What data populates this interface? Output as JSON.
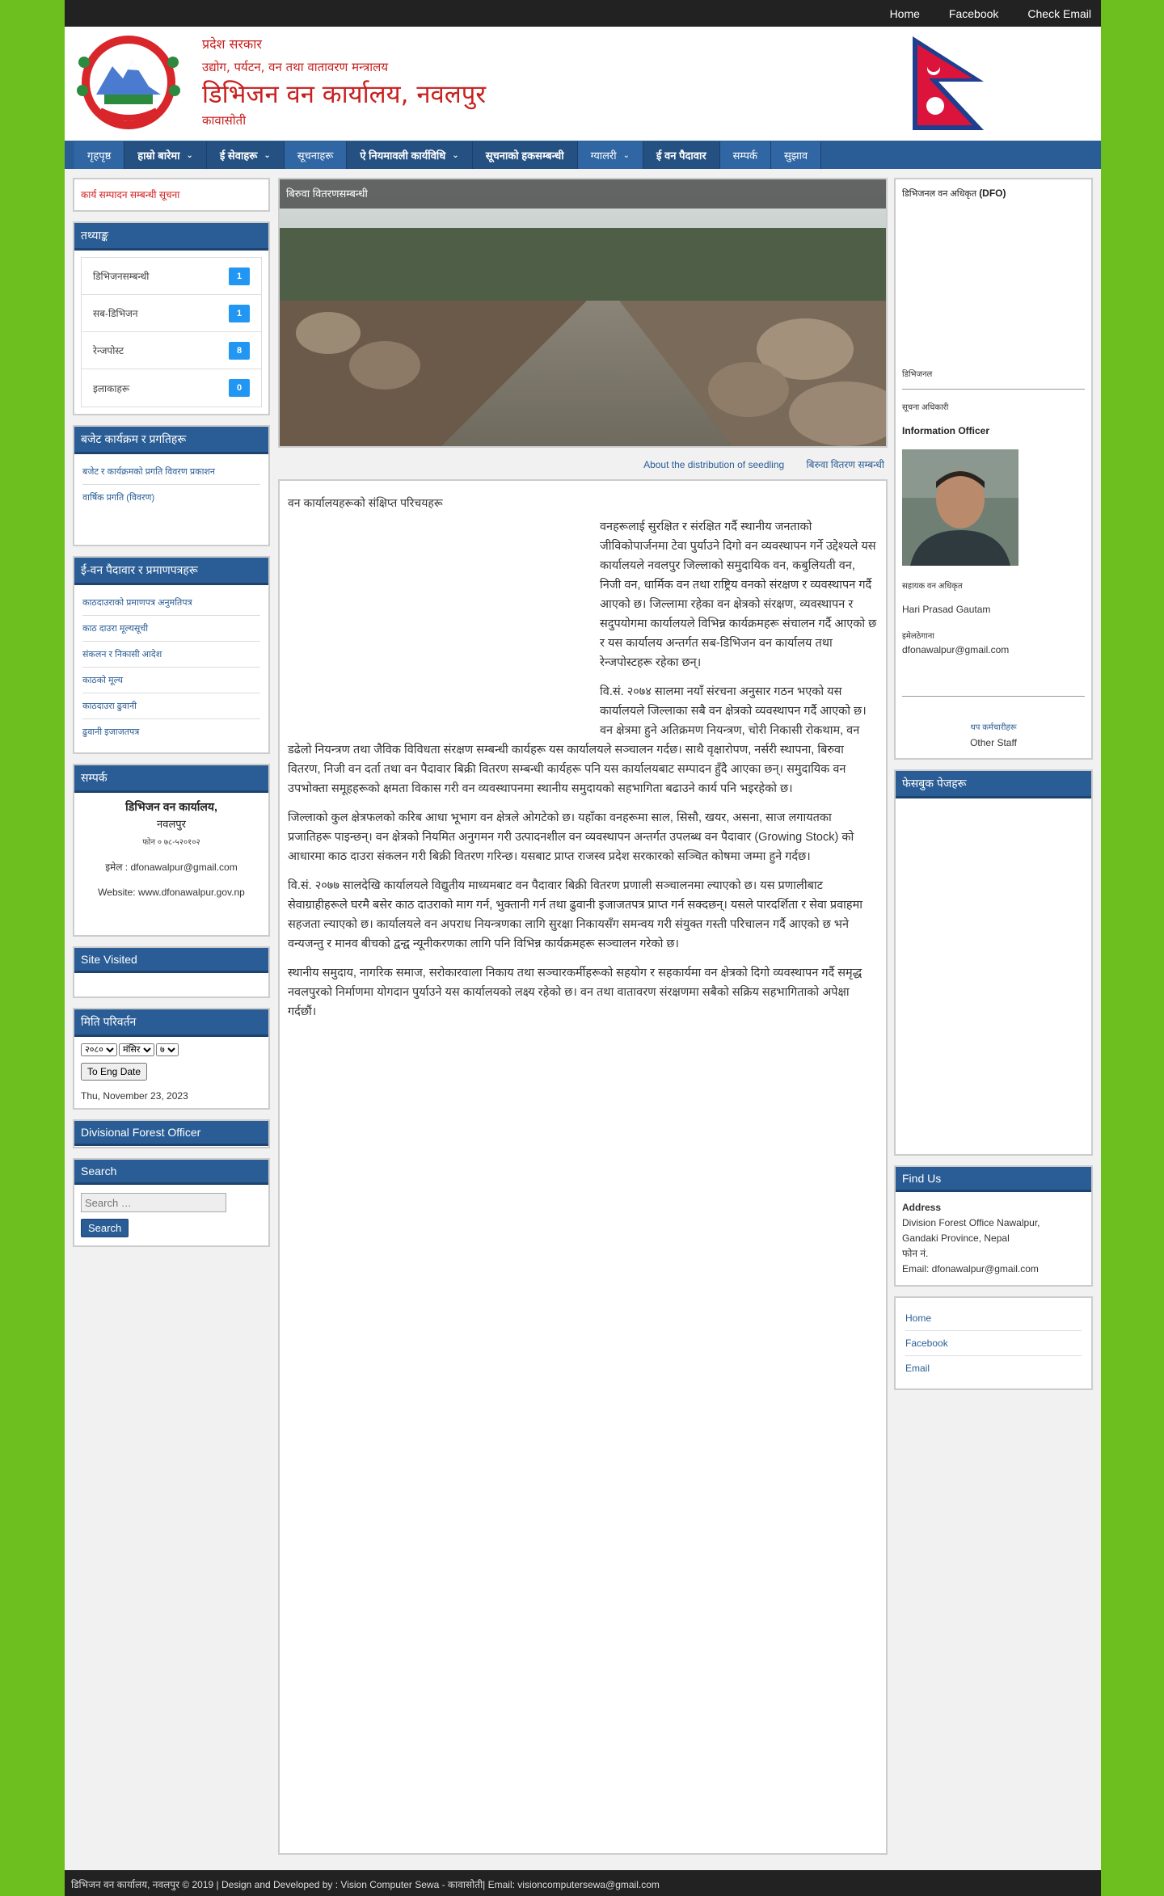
{
  "topbar": {
    "links": [
      "Home",
      "Facebook",
      "Check Email"
    ]
  },
  "header": {
    "line1": "प्रदेश सरकार",
    "line2": "उद्योग, पर्यटन, वन तथा वातावरण मन्त्रालय",
    "line3": "डिभिजन वन कार्यालय, नवलपुर",
    "line4": "कावासोती"
  },
  "nav": {
    "items": [
      {
        "label": "गृहपृष्ठ",
        "dropdown": false,
        "dark": false
      },
      {
        "label": "हाम्रो बारेमा",
        "dropdown": true,
        "dark": true
      },
      {
        "label": "ई सेवाहरू",
        "dropdown": true,
        "dark": true
      },
      {
        "label": "सूचनाहरू",
        "dropdown": false,
        "dark": false
      },
      {
        "label": "ऐ नियमावली कार्यविधि",
        "dropdown": true,
        "dark": true
      },
      {
        "label": "सूचनाको हकसम्बन्धी",
        "dropdown": false,
        "dark": true
      },
      {
        "label": "ग्यालरी",
        "dropdown": true,
        "dark": false
      },
      {
        "label": "ई वन पैदावार",
        "dropdown": false,
        "dark": true
      },
      {
        "label": "सम्पर्क",
        "dropdown": false,
        "dark": false
      },
      {
        "label": "सुझाव",
        "dropdown": false,
        "dark": false
      }
    ]
  },
  "left": {
    "notice": "कार्य सम्पादन सम्बन्धी सूचना",
    "stats_title": "तथ्याङ्क",
    "stats": [
      {
        "label": "डिभिजनसम्बन्धी",
        "count": "1"
      },
      {
        "label": "सब-डिभिजन",
        "count": "1"
      },
      {
        "label": "रेन्जपोस्ट",
        "count": "8"
      },
      {
        "label": "इलाकाहरू",
        "count": "0"
      }
    ],
    "links1_title": "बजेट कार्यक्रम र प्रगतिहरू",
    "links1": [
      "बजेट र कार्यक्रमको प्रगति विवरण प्रकाशन",
      "वार्षिक प्रगति (विवरण)"
    ],
    "links2_title": "ई-वन पैदावार र प्रमाणपत्रहरू",
    "links2": [
      "काठदाउराको प्रमाणपत्र अनुमतिपत्र",
      "काठ दाउरा मूल्यसूची",
      "संकलन र निकासी आदेश",
      "काठको मूल्य",
      "काठदाउरा ढुवानी",
      "ढुवानी इजाजतपत्र"
    ],
    "contact_title": "सम्पर्क",
    "contact_org": "डिभिजन वन कार्यालय,",
    "contact_sub": "नवलपुर",
    "contact_small": "फोन ० ७८-५२०१०२",
    "contact_email": "इमेल : dfonawalpur@gmail.com",
    "contact_web": "Website: www.dfonawalpur.gov.np",
    "visited_title": "Site Visited",
    "date_title": "मिति परिवर्तन",
    "date_selects": [
      "२०८०",
      "मंसिर",
      "७"
    ],
    "date_button": "To Eng Date",
    "date_today": "Thu, November 23, 2023",
    "dfo_title": "Divisional Forest Officer",
    "search_title": "Search",
    "search_placeholder": "Search …",
    "search_button": "Search"
  },
  "center": {
    "slide_caption": "बिरुवा वितरणसम्बन्धी",
    "slide_links": [
      "About the distribution of seedling",
      "बिरुवा वितरण सम्बन्धी"
    ],
    "article_title": "वन कार्यालयहरूको संक्षिप्त परिचयहरू",
    "paragraphs": [
      "वनहरूलाई सुरक्षित र संरक्षित गर्दै स्थानीय जनताको जीविकोपार्जनमा टेवा पुर्याउने दिगो वन व्यवस्थापन गर्ने उद्देश्यले यस कार्यालयले नवलपुर जिल्लाको समुदायिक वन, कबुलियती वन, निजी वन, धार्मिक वन तथा राष्ट्रिय वनको संरक्षण र व्यवस्थापन गर्दै आएको छ। जिल्लामा रहेका वन क्षेत्रको संरक्षण, व्यवस्थापन र सदुपयोगमा कार्यालयले विभिन्न कार्यक्रमहरू संचालन गर्दै आएको छ र यस कार्यालय अन्तर्गत सब-डिभिजन वन कार्यालय तथा रेन्जपोस्टहरू रहेका छन्।",
      "वि.सं. २०७४ सालमा नयाँ संरचना अनुसार गठन भएको यस कार्यालयले जिल्लाका सबै वन क्षेत्रको व्यवस्थापन गर्दै आएको छ। वन क्षेत्रमा हुने अतिक्रमण नियन्त्रण, चोरी निकासी रोकथाम, वन डढेलो नियन्त्रण तथा जैविक विविधता संरक्षण सम्बन्धी कार्यहरू यस कार्यालयले सञ्चालन गर्दछ। साथै वृक्षारोपण, नर्सरी स्थापना, बिरुवा वितरण, निजी वन दर्ता तथा वन पैदावार बिक्री वितरण सम्बन्धी कार्यहरू पनि यस कार्यालयबाट सम्पादन हुँदै आएका छन्। समुदायिक वन उपभोक्ता समूहहरूको क्षमता विकास गरी वन व्यवस्थापनमा स्थानीय समुदायको सहभागिता बढाउने कार्य पनि भइरहेको छ।",
      "जिल्लाको कुल क्षेत्रफलको करिब आधा भूभाग वन क्षेत्रले ओगटेको छ। यहाँका वनहरूमा साल, सिसौ, खयर, असना, साज लगायतका प्रजातिहरू पाइन्छन्। वन क्षेत्रको नियमित अनुगमन गरी उत्पादनशील वन व्यवस्थापन अन्तर्गत उपलब्ध वन पैदावार (Growing Stock) को आधारमा काठ दाउरा संकलन गरी बिक्री वितरण गरिन्छ। यसबाट प्राप्त राजस्व प्रदेश सरकारको सञ्चित कोषमा जम्मा हुने गर्दछ।",
      "वि.सं. २०७७ सालदेखि कार्यालयले विद्युतीय माध्यमबाट वन पैदावार बिक्री वितरण प्रणाली सञ्चालनमा ल्याएको छ। यस प्रणालीबाट सेवाग्राहीहरूले घरमै बसेर काठ दाउराको माग गर्न, भुक्तानी गर्न तथा ढुवानी इजाजतपत्र प्राप्त गर्न सक्दछन्। यसले पारदर्शिता र सेवा प्रवाहमा सहजता ल्याएको छ। कार्यालयले वन अपराध नियन्त्रणका लागि सुरक्षा निकायसँग समन्वय गरी संयुक्त गस्ती परिचालन गर्दै आएको छ भने वन्यजन्तु र मानव बीचको द्वन्द्व न्यूनीकरणका लागि पनि विभिन्न कार्यक्रमहरू सञ्चालन गरेको छ।",
      "स्थानीय समुदाय, नागरिक समाज, सरोकारवाला निकाय तथा सञ्चारकर्मीहरूको सहयोग र सहकार्यमा वन क्षेत्रको दिगो व्यवस्थापन गर्दै समृद्ध नवलपुरको निर्माणमा योगदान पुर्याउने यस कार्यालयको लक्ष्य रहेको छ। वन तथा वातावरण संरक्षणमा सबैको सक्रिय सहभागिताको अपेक्षा गर्दछौं।"
    ]
  },
  "right": {
    "dfo_label": "डिभिजनल वन अधिकृत",
    "dfo_abbr": "(DFO)",
    "dfo_role": "डिभिजनल",
    "dfo_role2": "सूचना अधिकारी",
    "info_officer": "Information Officer",
    "info_role": "सहायक वन अधिकृत",
    "info_name": "Hari Prasad Gautam",
    "info_email_label": "इमेलठेगाना",
    "info_email": "dfonawalpur@gmail.com",
    "more_link": "थप कर्मचारीहरू",
    "other_staff": "Other Staff",
    "fb_title": "फेसबुक पेजहरू",
    "findus_title": "Find Us",
    "findus_label": "Address",
    "findus_addr1": "Division Forest Office Nawalpur,",
    "findus_addr2": "Gandaki Province, Nepal",
    "findus_phone": "फोन नं.",
    "findus_email": "Email: dfonawalpur@gmail.com",
    "quick_links": [
      "Home",
      "Facebook",
      "Email"
    ]
  },
  "footer": {
    "text": "डिभिजन वन कार्यालय, नवलपुर © 2019 | Design and Developed by : Vision Computer Sewa - कावासोती| Email: visioncomputersewa@gmail.com"
  },
  "colors": {
    "nav": "#2a5d95",
    "background": "#6cbf1e",
    "header_text": "#c8201f",
    "badge": "#2196f3"
  }
}
